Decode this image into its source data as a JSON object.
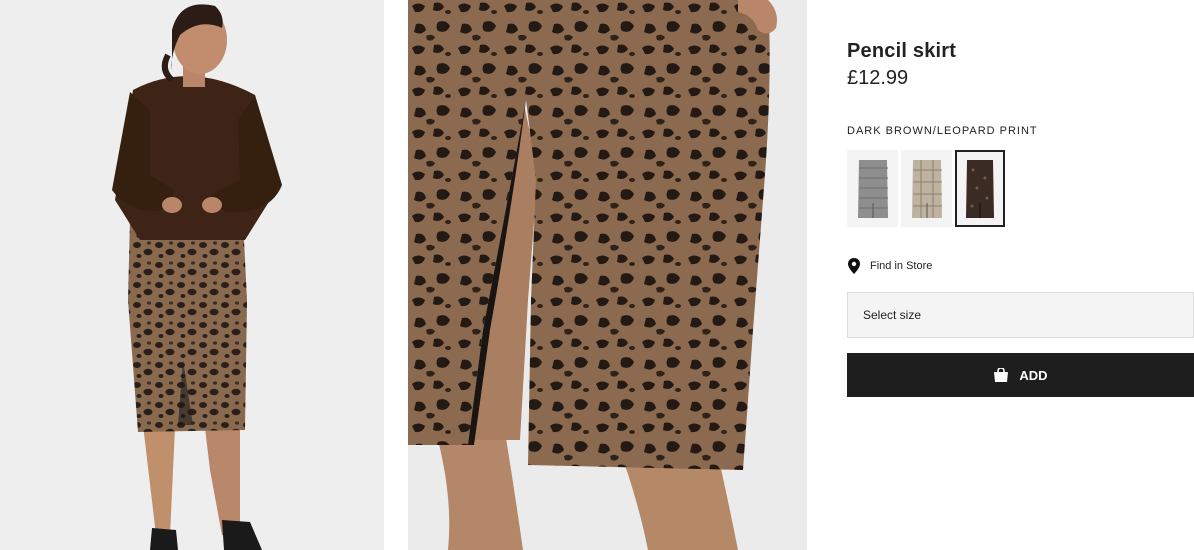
{
  "product": {
    "title": "Pencil skirt",
    "price": "£12.99",
    "color_label": "DARK BROWN/LEOPARD PRINT",
    "swatches": [
      {
        "name": "grey-check",
        "color": "#8e8e8e",
        "selected": false
      },
      {
        "name": "beige-check",
        "color": "#bdb3a0",
        "selected": false
      },
      {
        "name": "dark-brown-leopard",
        "color": "#3a2b24",
        "selected": true
      }
    ]
  },
  "actions": {
    "find_in_store": "Find in Store",
    "select_size": "Select size",
    "add": "ADD"
  },
  "icons": {
    "location": "location-pin-icon",
    "bag": "shopping-bag-icon"
  },
  "colors": {
    "background": "#ffffff",
    "image_bg": "#efefef",
    "button_bg": "#1e1e1e",
    "select_bg": "#f4f4f4",
    "sweater": "#3e2417",
    "leopard_base": "#8b6a50"
  }
}
